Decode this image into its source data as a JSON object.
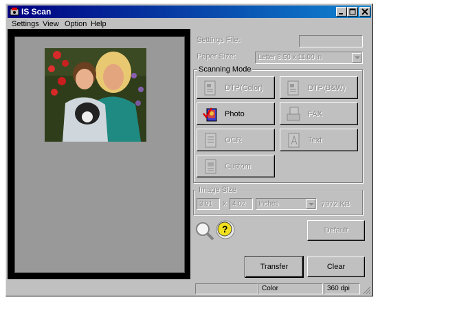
{
  "window": {
    "title": "IS Scan"
  },
  "menubar": {
    "items": [
      "Settings",
      "View",
      "Option",
      "Help"
    ]
  },
  "settings": {
    "settings_file_label": "Settings File:",
    "settings_file_value": "",
    "paper_size_label": "Paper Size:",
    "paper_size_value": "Letter 8.50 x 11.00 in"
  },
  "scanning_mode": {
    "title": "Scanning Mode",
    "buttons": [
      {
        "label": "DTP(Color)",
        "icon": "dtp-color-icon",
        "enabled": false
      },
      {
        "label": "DTP(B&W)",
        "icon": "dtp-bw-icon",
        "enabled": false
      },
      {
        "label": "Photo",
        "icon": "photo-icon",
        "enabled": true,
        "selected": true
      },
      {
        "label": "FAX",
        "icon": "fax-icon",
        "enabled": false
      },
      {
        "label": "OCR",
        "icon": "ocr-icon",
        "enabled": false
      },
      {
        "label": "Text",
        "icon": "text-icon",
        "enabled": false
      },
      {
        "label": "Custom",
        "icon": "custom-icon",
        "enabled": false
      }
    ]
  },
  "image_size": {
    "title": "Image Size",
    "width": "3.91",
    "separator": "x",
    "height": "4.02",
    "unit": "Inches",
    "filesize": "7972 KB"
  },
  "actions": {
    "zoom_icon": "magnifier-icon",
    "help_icon": "help-question-icon",
    "default_label": "Default",
    "transfer_label": "Transfer",
    "clear_label": "Clear"
  },
  "statusbar": {
    "panel1": "",
    "color_mode": "Color",
    "resolution": "360 dpi"
  },
  "colors": {
    "titlebar_start": "#000080",
    "titlebar_end": "#1084d0",
    "face": "#c0c0c0",
    "preview_bg": "#999999"
  }
}
